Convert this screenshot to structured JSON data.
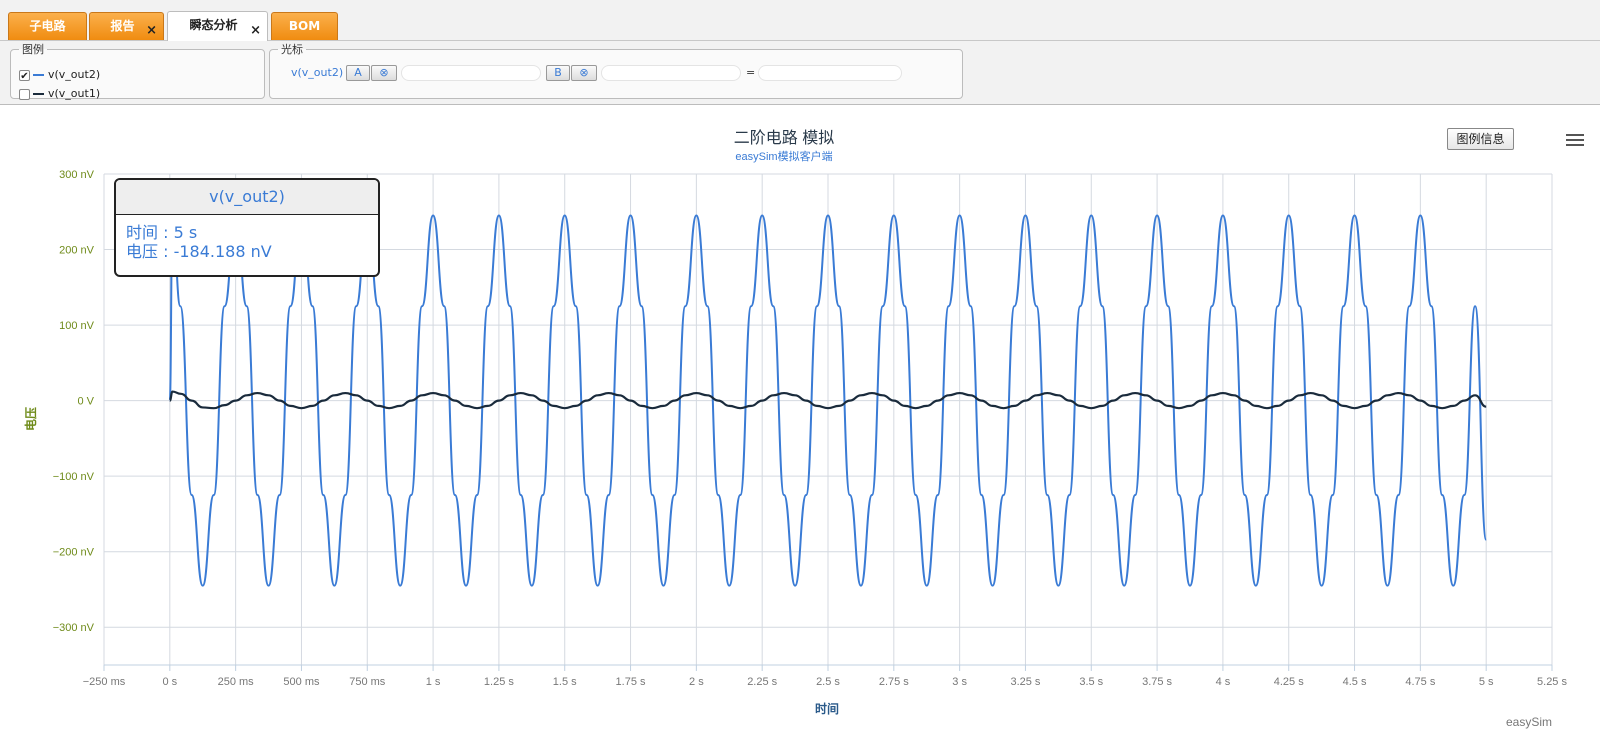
{
  "tabs": [
    {
      "label": "子电路",
      "closable": false,
      "active": false
    },
    {
      "label": "报告",
      "closable": true,
      "active": false
    },
    {
      "label": "瞬态分析",
      "closable": true,
      "active": true
    },
    {
      "label": "BOM",
      "closable": false,
      "active": false
    }
  ],
  "tab_close_glyph": "×",
  "legend_panel": {
    "title": "图例",
    "items": [
      {
        "label": "v(v_out2)",
        "checked": true,
        "color": "#3a7bd5"
      },
      {
        "label": "v(v_out1)",
        "checked": false,
        "color": "#1a2b3c"
      }
    ]
  },
  "cursor_panel": {
    "title": "光标",
    "signal": "v(v_out2)",
    "button_a": "A",
    "button_b": "B",
    "clear_glyph": "⊗",
    "equals": "="
  },
  "legend_info_button": "图例信息",
  "credits": "easySim",
  "tooltip": {
    "series": "v(v_out2)",
    "time_label": "时间",
    "time_value": "5 s",
    "voltage_label": "电压",
    "voltage_value": "-184.188 nV"
  },
  "chart_data": {
    "type": "line",
    "title": "二阶电路 模拟",
    "subtitle": "easySim模拟客户端",
    "xlabel": "时间",
    "ylabel": "电压",
    "xlim": [
      -0.25,
      5.25
    ],
    "ylim": [
      -350,
      300
    ],
    "x_ticks": [
      -0.25,
      0,
      0.25,
      0.5,
      0.75,
      1,
      1.25,
      1.5,
      1.75,
      2,
      2.25,
      2.5,
      2.75,
      3,
      3.25,
      3.5,
      3.75,
      4,
      4.25,
      4.5,
      4.75,
      5,
      5.25
    ],
    "x_tick_labels": [
      "−250 ms",
      "0 s",
      "250 ms",
      "500 ms",
      "750 ms",
      "1 s",
      "1.25 s",
      "1.5 s",
      "1.75 s",
      "2 s",
      "2.25 s",
      "2.5 s",
      "2.75 s",
      "3 s",
      "3.25 s",
      "3.5 s",
      "3.75 s",
      "4 s",
      "4.25 s",
      "4.5 s",
      "4.75 s",
      "5 s",
      "5.25 s"
    ],
    "y_ticks": [
      300,
      200,
      100,
      0,
      -100,
      -200,
      -300
    ],
    "y_tick_labels": [
      "300 nV",
      "200 nV",
      "100 nV",
      "0 V",
      "−100 nV",
      "−200 nV",
      "−300 nV"
    ],
    "grid": true,
    "series": [
      {
        "name": "v(v_out2)",
        "color": "#3a7bd5",
        "x": [
          0,
          0.01,
          0.04,
          0.083,
          0.125,
          0.167,
          0.208,
          0.25,
          0.292,
          0.333,
          0.375,
          0.417,
          0.458,
          0.5,
          0.542,
          0.583,
          0.625,
          0.667,
          0.708,
          0.75,
          0.792,
          0.833,
          0.875,
          0.917,
          0.958,
          1.0,
          1.042,
          1.083,
          1.125,
          1.167,
          1.208,
          1.25,
          1.292,
          1.333,
          1.375,
          1.417,
          1.458,
          1.5,
          1.542,
          1.583,
          1.625,
          1.667,
          1.708,
          1.75,
          1.792,
          1.833,
          1.875,
          1.917,
          1.958,
          2.0,
          2.042,
          2.083,
          2.125,
          2.167,
          2.208,
          2.25,
          2.292,
          2.333,
          2.375,
          2.417,
          2.458,
          2.5,
          2.542,
          2.583,
          2.625,
          2.667,
          2.708,
          2.75,
          2.792,
          2.833,
          2.875,
          2.917,
          2.958,
          3.0,
          3.042,
          3.083,
          3.125,
          3.167,
          3.208,
          3.25,
          3.292,
          3.333,
          3.375,
          3.417,
          3.458,
          3.5,
          3.542,
          3.583,
          3.625,
          3.667,
          3.708,
          3.75,
          3.792,
          3.833,
          3.875,
          3.917,
          3.958,
          4.0,
          4.042,
          4.083,
          4.125,
          4.167,
          4.208,
          4.25,
          4.292,
          4.333,
          4.375,
          4.417,
          4.458,
          4.5,
          4.542,
          4.583,
          4.625,
          4.667,
          4.708,
          4.75,
          4.792,
          4.833,
          4.875,
          4.917,
          4.958,
          5.0
        ],
        "y": [
          0,
          240,
          125,
          -125,
          -245,
          -125,
          125,
          245,
          125,
          -125,
          -245,
          -125,
          125,
          245,
          125,
          -125,
          -245,
          -125,
          125,
          245,
          125,
          -125,
          -245,
          -125,
          125,
          245,
          125,
          -125,
          -245,
          -125,
          125,
          245,
          125,
          -125,
          -245,
          -125,
          125,
          245,
          125,
          -125,
          -245,
          -125,
          125,
          245,
          125,
          -125,
          -245,
          -125,
          125,
          245,
          125,
          -125,
          -245,
          -125,
          125,
          245,
          125,
          -125,
          -245,
          -125,
          125,
          245,
          125,
          -125,
          -245,
          -125,
          125,
          245,
          125,
          -125,
          -245,
          -125,
          125,
          245,
          125,
          -125,
          -245,
          -125,
          125,
          245,
          125,
          -125,
          -245,
          -125,
          125,
          245,
          125,
          -125,
          -245,
          -125,
          125,
          245,
          125,
          -125,
          -245,
          -125,
          125,
          245,
          125,
          -125,
          -245,
          -125,
          125,
          245,
          125,
          -125,
          -245,
          -125,
          125,
          245,
          125,
          -125,
          -245,
          -125,
          125,
          245,
          125,
          -125,
          -245,
          -125,
          125,
          -184.188
        ]
      },
      {
        "name": "v(v_out1)",
        "color": "#1a2b3c",
        "x": [
          0,
          0.01,
          0.042,
          0.083,
          0.125,
          0.167,
          0.208,
          0.25,
          0.292,
          0.333,
          0.375,
          0.417,
          0.458,
          0.5,
          0.542,
          0.583,
          0.625,
          0.667,
          0.708,
          0.75,
          0.792,
          0.833,
          0.875,
          0.917,
          0.958,
          1.0,
          1.042,
          1.083,
          1.125,
          1.167,
          1.208,
          1.25,
          1.292,
          1.333,
          1.375,
          1.417,
          1.458,
          1.5,
          1.542,
          1.583,
          1.625,
          1.667,
          1.708,
          1.75,
          1.792,
          1.833,
          1.875,
          1.917,
          1.958,
          2.0,
          2.042,
          2.083,
          2.125,
          2.167,
          2.208,
          2.25,
          2.292,
          2.333,
          2.375,
          2.417,
          2.458,
          2.5,
          2.542,
          2.583,
          2.625,
          2.667,
          2.708,
          2.75,
          2.792,
          2.833,
          2.875,
          2.917,
          2.958,
          3.0,
          3.042,
          3.083,
          3.125,
          3.167,
          3.208,
          3.25,
          3.292,
          3.333,
          3.375,
          3.417,
          3.458,
          3.5,
          3.542,
          3.583,
          3.625,
          3.667,
          3.708,
          3.75,
          3.792,
          3.833,
          3.875,
          3.917,
          3.958,
          4.0,
          4.042,
          4.083,
          4.125,
          4.167,
          4.208,
          4.25,
          4.292,
          4.333,
          4.375,
          4.417,
          4.458,
          4.5,
          4.542,
          4.583,
          4.625,
          4.667,
          4.708,
          4.75,
          4.792,
          4.833,
          4.875,
          4.917,
          4.958,
          5.0
        ],
        "y": [
          0,
          12,
          9,
          0,
          -9,
          -10,
          -6,
          0,
          7,
          10,
          7,
          0,
          -7,
          -10,
          -7,
          0,
          7,
          10,
          7,
          0,
          -7,
          -10,
          -7,
          0,
          7,
          10,
          7,
          0,
          -7,
          -10,
          -7,
          0,
          7,
          10,
          7,
          0,
          -7,
          -10,
          -7,
          0,
          7,
          10,
          7,
          0,
          -7,
          -10,
          -7,
          0,
          7,
          10,
          7,
          0,
          -7,
          -10,
          -7,
          0,
          7,
          10,
          7,
          0,
          -7,
          -10,
          -7,
          0,
          7,
          10,
          7,
          0,
          -7,
          -10,
          -7,
          0,
          7,
          10,
          7,
          0,
          -7,
          -10,
          -7,
          0,
          7,
          10,
          7,
          0,
          -7,
          -10,
          -7,
          0,
          7,
          10,
          7,
          0,
          -7,
          -10,
          -7,
          0,
          7,
          10,
          7,
          0,
          -7,
          -10,
          -7,
          0,
          7,
          10,
          7,
          0,
          -7,
          -10,
          -7,
          0,
          7,
          10,
          7,
          0,
          -7,
          -10,
          -7,
          0,
          7,
          -8
        ]
      }
    ]
  }
}
